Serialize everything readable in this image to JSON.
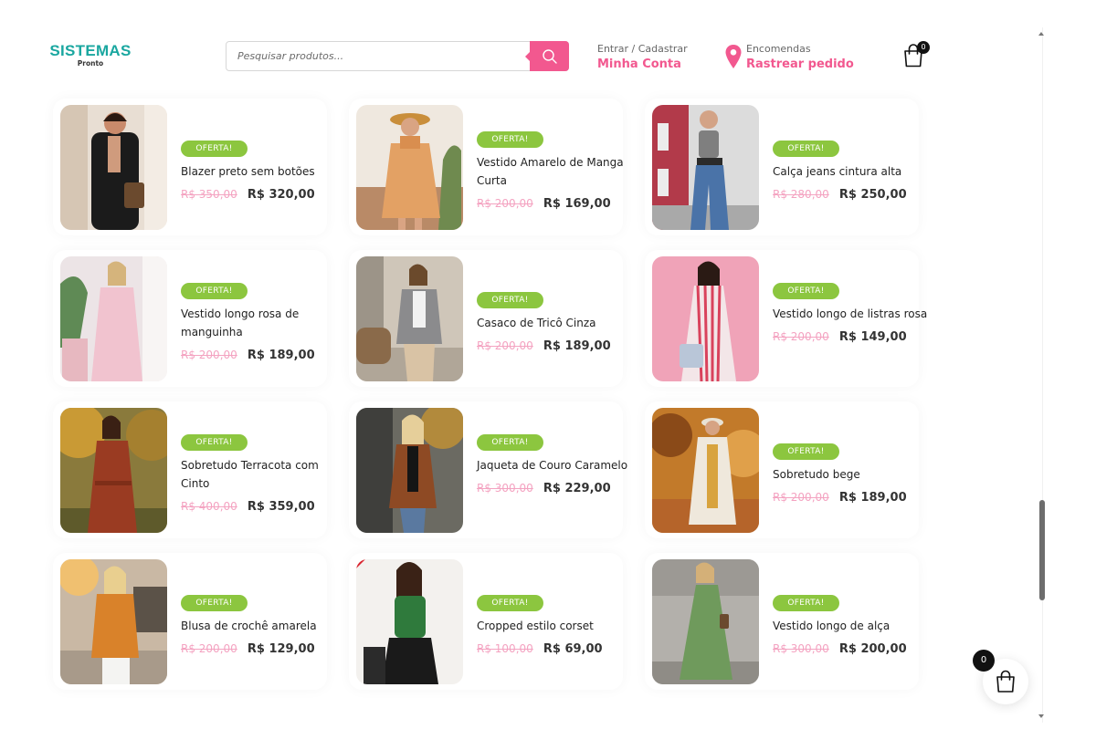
{
  "header": {
    "logo_main": "SISTEMAS",
    "logo_sub": "Pronto",
    "search_placeholder": "Pesquisar produtos...",
    "account_small": "Entrar / Cadastrar",
    "account_link": "Minha Conta",
    "orders_small": "Encomendas",
    "orders_link": "Rastrear pedido",
    "cart_count": "0"
  },
  "colors": {
    "brand_teal": "#1aa7a0",
    "accent_pink": "#f2588f",
    "badge_green": "#8cc63f",
    "old_price_pink": "#f4a3c1"
  },
  "products": [
    {
      "badge": "OFERTA!",
      "name": "Blazer preto sem botões",
      "old_price": "R$ 350,00",
      "price": "R$ 320,00",
      "image": "woman-black-blazer"
    },
    {
      "badge": "OFERTA!",
      "name": "Vestido Amarelo de Manga Curta",
      "old_price": "R$ 200,00",
      "price": "R$ 169,00",
      "image": "woman-yellow-dress-hat"
    },
    {
      "badge": "OFERTA!",
      "name": "Calça jeans cintura alta",
      "old_price": "R$ 280,00",
      "price": "R$ 250,00",
      "image": "woman-high-waist-jeans"
    },
    {
      "badge": "OFERTA!",
      "name": "Vestido longo rosa de manguinha",
      "old_price": "R$ 200,00",
      "price": "R$ 189,00",
      "image": "woman-long-pink-dress"
    },
    {
      "badge": "OFERTA!",
      "name": "Casaco de Tricô Cinza",
      "old_price": "R$ 200,00",
      "price": "R$ 189,00",
      "image": "woman-grey-knit-coat"
    },
    {
      "badge": "OFERTA!",
      "name": "Vestido longo de listras rosa",
      "old_price": "R$ 200,00",
      "price": "R$ 149,00",
      "image": "woman-pink-striped-dress"
    },
    {
      "badge": "OFERTA!",
      "name": "Sobretudo Terracota com Cinto",
      "old_price": "R$ 400,00",
      "price": "R$ 359,00",
      "image": "woman-terracotta-coat"
    },
    {
      "badge": "OFERTA!",
      "name": "Jaqueta de Couro Caramelo",
      "old_price": "R$ 300,00",
      "price": "R$ 229,00",
      "image": "woman-caramel-leather-jacket"
    },
    {
      "badge": "OFERTA!",
      "name": "Sobretudo bege",
      "old_price": "R$ 200,00",
      "price": "R$ 189,00",
      "image": "woman-beige-overcoat"
    },
    {
      "badge": "OFERTA!",
      "name": "Blusa de crochê amarela",
      "old_price": "R$ 200,00",
      "price": "R$ 129,00",
      "image": "woman-yellow-crochet-sweater"
    },
    {
      "badge": "OFERTA!",
      "name": "Cropped estilo corset",
      "old_price": "R$ 100,00",
      "price": "R$ 69,00",
      "image": "woman-green-corset-top"
    },
    {
      "badge": "OFERTA!",
      "name": "Vestido longo de alça",
      "old_price": "R$ 300,00",
      "price": "R$ 200,00",
      "image": "woman-green-strap-dress"
    }
  ],
  "floating_cart": {
    "count": "0"
  }
}
